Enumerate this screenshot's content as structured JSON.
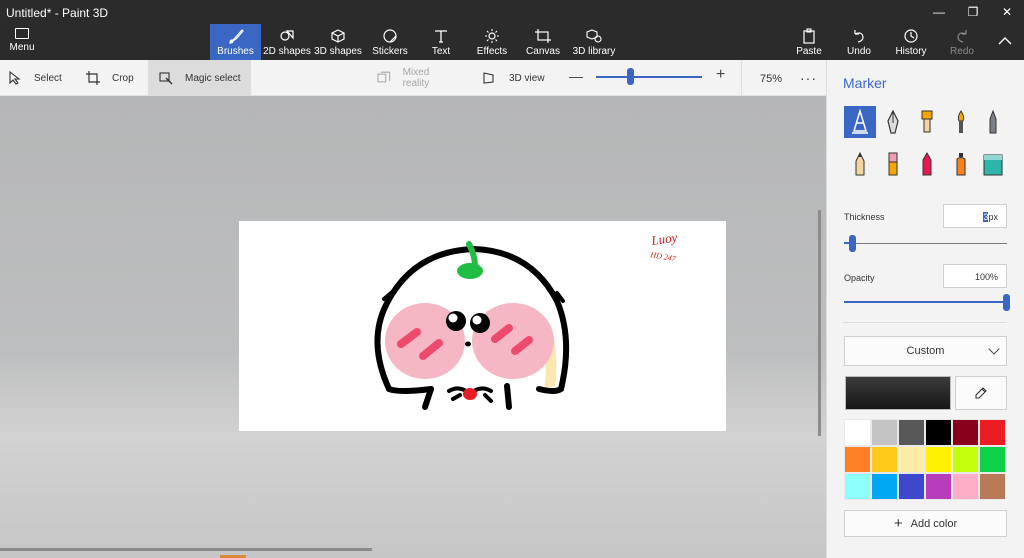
{
  "window": {
    "title": "Untitled* - Paint 3D",
    "controls": [
      "—",
      "❐",
      "✕"
    ]
  },
  "menu": {
    "label": "Menu"
  },
  "tools": [
    {
      "label": "Brushes",
      "icon": "brush-icon",
      "active": true
    },
    {
      "label": "2D shapes",
      "icon": "shapes-2d-icon"
    },
    {
      "label": "3D shapes",
      "icon": "shapes-3d-icon"
    },
    {
      "label": "Stickers",
      "icon": "sticker-icon"
    },
    {
      "label": "Text",
      "icon": "text-icon"
    },
    {
      "label": "Effects",
      "icon": "effects-icon"
    },
    {
      "label": "Canvas",
      "icon": "canvas-icon"
    },
    {
      "label": "3D library",
      "icon": "library-icon"
    }
  ],
  "actions": [
    {
      "label": "Paste",
      "icon": "paste-icon"
    },
    {
      "label": "Undo",
      "icon": "undo-icon"
    },
    {
      "label": "History",
      "icon": "history-icon"
    },
    {
      "label": "Redo",
      "icon": "redo-icon",
      "disabled": true
    }
  ],
  "subbar": {
    "select": "Select",
    "crop": "Crop",
    "magic_select": "Magic select",
    "mixed_reality": "Mixed reality",
    "view3d": "3D view",
    "zoom_value": "75%",
    "zoom_level": 0.32,
    "more": "···"
  },
  "panel": {
    "title": "Marker",
    "brushes": [
      {
        "name": "marker",
        "active": true
      },
      {
        "name": "calligraphy-pen"
      },
      {
        "name": "oil-brush"
      },
      {
        "name": "watercolor"
      },
      {
        "name": "pixel-pen"
      },
      {
        "name": "pencil"
      },
      {
        "name": "eraser"
      },
      {
        "name": "crayon"
      },
      {
        "name": "spray-can"
      },
      {
        "name": "fill"
      }
    ],
    "thickness_label": "Thickness",
    "thickness_value": "3",
    "thickness_unit": "px",
    "thickness_level": 0.05,
    "opacity_label": "Opacity",
    "opacity_value": "100%",
    "opacity_level": 1.0,
    "color_mode": "Custom",
    "selected_color": "#1c1c1c",
    "add_color": "Add color",
    "palette": [
      "#ffffff",
      "#c3c3c3",
      "#585858",
      "#000000",
      "#88001b",
      "#ec1c24",
      "#ff7f27",
      "#ffca18",
      "#fdeca6",
      "#fff200",
      "#c4ff0e",
      "#0ed145",
      "#8cfffb",
      "#00a8f3",
      "#3f48cc",
      "#b83dba",
      "#ffaec8",
      "#b97a57"
    ]
  },
  "canvas_text": {
    "signature": "Luoy",
    "sub": "HD 247"
  }
}
